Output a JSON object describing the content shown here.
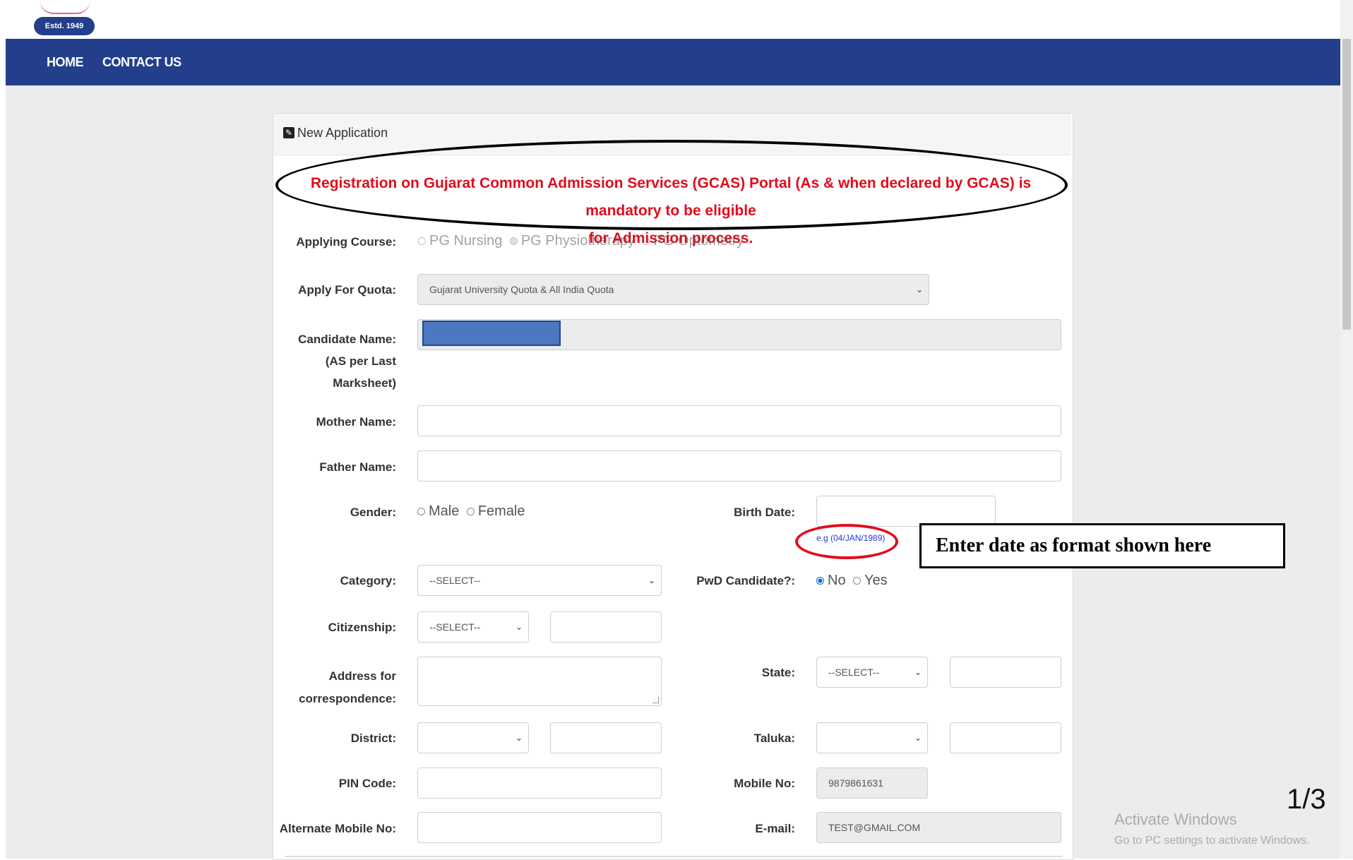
{
  "header": {
    "logo_badge": "Estd. 1949"
  },
  "nav": {
    "items": [
      "HOME",
      "CONTACT US"
    ]
  },
  "panel": {
    "title": "New Application",
    "notice_line1": "Registration on Gujarat Common Admission Services (GCAS) Portal (As & when declared by GCAS) is mandatory to be eligible",
    "notice_line2": "for Admission process."
  },
  "form": {
    "applying_course_label": "Applying Course:",
    "courses": [
      "PG Nursing",
      "PG Physiotherapy",
      "PG Optometry"
    ],
    "quota_label": "Apply For Quota:",
    "quota_value": "Gujarat University Quota & All India Quota",
    "candidate_label_1": "Candidate Name:",
    "candidate_label_2": "(AS per Last",
    "candidate_label_3": "Marksheet)",
    "mother_label": "Mother Name:",
    "father_label": "Father Name:",
    "gender_label": "Gender:",
    "gender_options": [
      "Male",
      "Female"
    ],
    "birth_label": "Birth Date:",
    "birth_hint": "e.g (04/JAN/1989)",
    "category_label": "Category:",
    "category_value": "--SELECT--",
    "pwd_label": "PwD Candidate?:",
    "pwd_options": [
      "No",
      "Yes"
    ],
    "citizenship_label": "Citizenship:",
    "citizenship_value": "--SELECT--",
    "address_label_1": "Address for",
    "address_label_2": "correspondence:",
    "state_label": "State:",
    "state_value": "--SELECT--",
    "district_label": "District:",
    "taluka_label": "Taluka:",
    "pin_label": "PIN Code:",
    "mobile_label": "Mobile No:",
    "mobile_value": "9879861631",
    "alt_mobile_label": "Alternate Mobile No:",
    "email_label": "E-mail:",
    "email_value": "TEST@GMAIL.COM"
  },
  "annotation": {
    "callout": "Enter date as format shown here",
    "page": "1/3"
  },
  "watermark": {
    "title": "Activate Windows",
    "subtitle": "Go to PC settings to activate Windows."
  }
}
